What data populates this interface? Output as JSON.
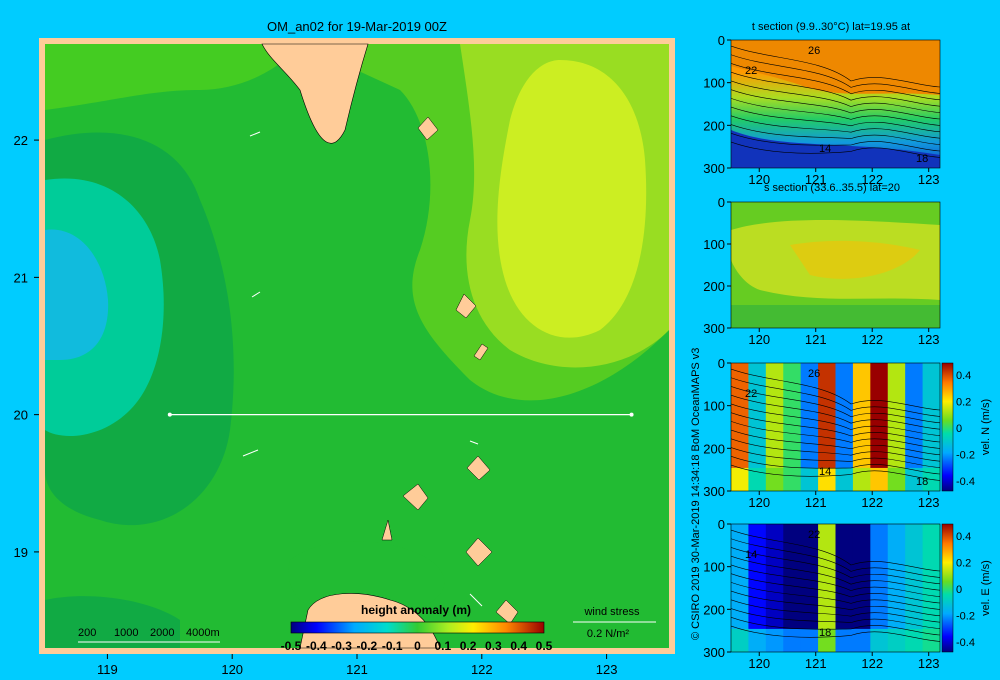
{
  "title": "OM_an02 for 19-Mar-2019 00Z",
  "credit": "© CSIRO 2019   30-Mar-2019 14:34:18 BoM OceanMAPS v3",
  "colors": {
    "background": "#00ccff",
    "frame": "#ffcc99",
    "land": "#ffcc99"
  },
  "chart_data": [
    {
      "type": "heatmap",
      "name": "main-map",
      "title": "OM_an02 for 19-Mar-2019 00Z",
      "xlim": [
        118.5,
        123.5
      ],
      "ylim": [
        18.3,
        22.7
      ],
      "xticks": [
        "119",
        "120",
        "121",
        "122",
        "123"
      ],
      "yticks": [
        "19",
        "20",
        "21",
        "22"
      ],
      "colorbar": {
        "label": "height anomaly (m)",
        "ticks": [
          "-0.5",
          "-0.4",
          "-0.3",
          "-0.2",
          "-0.1",
          "0",
          "0.1",
          "0.2",
          "0.3",
          "0.4",
          "0.5"
        ],
        "range": [
          -0.5,
          0.5
        ]
      },
      "depth_legend": [
        "200",
        "1000",
        "2000",
        "4000m"
      ],
      "section_line": {
        "lat": 20,
        "lon_start": 119.5,
        "lon_end": 123.2
      },
      "wind_stress_label": "wind stress",
      "wind_stress_scale": "0.2 N/m²",
      "field_levels": [
        {
          "value": -0.2,
          "region": "west-core"
        },
        {
          "value": -0.1,
          "region": "west"
        },
        {
          "value": 0.0,
          "region": "west-mid"
        },
        {
          "value": 0.1,
          "region": "center-south"
        },
        {
          "value": 0.15,
          "region": "center"
        },
        {
          "value": 0.2,
          "region": "east"
        },
        {
          "value": 0.25,
          "region": "east-core"
        }
      ]
    },
    {
      "type": "heatmap",
      "name": "t-section",
      "title": "t section (9.9..30°C) lat=19.95 at",
      "xlim": [
        119.5,
        123.2
      ],
      "ylim": [
        300,
        0
      ],
      "xticks": [
        "120",
        "121",
        "122",
        "123"
      ],
      "yticks": [
        "0",
        "100",
        "200",
        "300"
      ],
      "contour_labels": [
        "26",
        "22",
        "14",
        "18"
      ]
    },
    {
      "type": "heatmap",
      "name": "s-section",
      "title": "s section (33.6..35.5) lat=20",
      "xlim": [
        119.5,
        123.2
      ],
      "ylim": [
        300,
        0
      ],
      "xticks": [
        "120",
        "121",
        "122",
        "123"
      ],
      "yticks": [
        "0",
        "100",
        "200",
        "300"
      ]
    },
    {
      "type": "heatmap",
      "name": "vel-n-section",
      "xlim": [
        119.5,
        123.2
      ],
      "ylim": [
        300,
        0
      ],
      "xticks": [
        "120",
        "121",
        "122",
        "123"
      ],
      "yticks": [
        "0",
        "100",
        "200",
        "300"
      ],
      "contour_labels": [
        "26",
        "22",
        "14",
        "18"
      ],
      "colorbar": {
        "label": "vel. N (m/s)",
        "ticks": [
          "0.4",
          "0.2",
          "0",
          "-0.2",
          "-0.4"
        ],
        "range": [
          -0.4,
          0.4
        ]
      },
      "column_values": [
        0.3,
        -0.1,
        0.1,
        0.0,
        -0.2,
        0.35,
        -0.2,
        0.2,
        0.4,
        0.1,
        -0.2,
        -0.1
      ]
    },
    {
      "type": "heatmap",
      "name": "vel-e-section",
      "xlim": [
        119.5,
        123.2
      ],
      "ylim": [
        300,
        0
      ],
      "xticks": [
        "120",
        "121",
        "122",
        "123"
      ],
      "yticks": [
        "0",
        "100",
        "200",
        "300"
      ],
      "contour_labels": [
        "22",
        "14",
        "18"
      ],
      "colorbar": {
        "label": "vel. E (m/s)",
        "ticks": [
          "0.4",
          "0.2",
          "0",
          "-0.2",
          "-0.4"
        ],
        "range": [
          -0.4,
          0.4
        ]
      },
      "column_values": [
        -0.15,
        -0.3,
        -0.35,
        -0.4,
        -0.4,
        0.1,
        -0.4,
        -0.4,
        -0.2,
        -0.15,
        -0.1,
        -0.05
      ]
    }
  ]
}
